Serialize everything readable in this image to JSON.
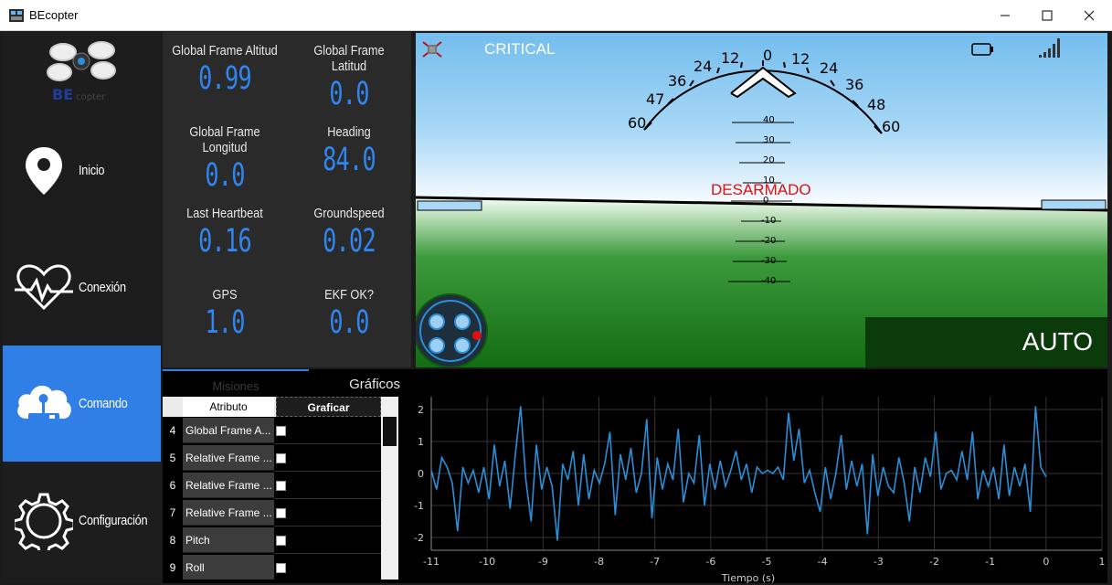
{
  "window": {
    "title": "BEcopter",
    "min": "—",
    "max": "☐",
    "close": "✕"
  },
  "sidebar": {
    "logo_text": "BEcopter",
    "items": [
      {
        "label": "Inicio",
        "icon": "location-pin-icon"
      },
      {
        "label": "Conexión",
        "icon": "heartbeat-icon"
      },
      {
        "label": "Comando",
        "icon": "cloud-joystick-icon"
      },
      {
        "label": "Configuración",
        "icon": "gear-icon"
      }
    ]
  },
  "telemetry": [
    {
      "label": "Global Frame Altitud",
      "value": "0.99"
    },
    {
      "label": "Global Frame Latitud",
      "value": "0.0"
    },
    {
      "label": "Global Frame Longitud",
      "value": "0.0"
    },
    {
      "label": "Heading",
      "value": "84.0"
    },
    {
      "label": "Last Heartbeat",
      "value": "0.16"
    },
    {
      "label": "Groundspeed",
      "value": "0.02"
    },
    {
      "label": "GPS",
      "value": "1.0"
    },
    {
      "label": "EKF OK?",
      "value": "0.0"
    }
  ],
  "hud": {
    "status": "CRITICAL",
    "armed_text": "DESARMADO",
    "mode": "AUTO",
    "roll_labels": [
      "60",
      "47",
      "36",
      "24",
      "12",
      "0",
      "12",
      "24",
      "36",
      "48",
      "60"
    ],
    "pitch_labels": [
      "40",
      "30",
      "20",
      "10",
      "0",
      "-10",
      "-20",
      "-30",
      "-40"
    ],
    "quad_badge": "2",
    "colors": {
      "sky": "#7cc3f0",
      "ground": "#1a7a1a",
      "warning": "#e01010"
    }
  },
  "tabs": {
    "misiones": "Misiones",
    "graficos": "Gráficos"
  },
  "table": {
    "headers": {
      "attribute": "Atributo",
      "plot": "Graficar"
    },
    "rows": [
      {
        "num": "4",
        "name": "Global Frame A..."
      },
      {
        "num": "5",
        "name": "Relative Frame ..."
      },
      {
        "num": "6",
        "name": "Relative Frame ..."
      },
      {
        "num": "7",
        "name": "Relative Frame ..."
      },
      {
        "num": "8",
        "name": "Pitch"
      },
      {
        "num": "9",
        "name": "Roll"
      }
    ]
  },
  "chart_data": {
    "type": "line",
    "xlabel": "Tiempo (s)",
    "ylabel": "",
    "xlim": [
      -11,
      1
    ],
    "ylim": [
      -2.4,
      2.4
    ],
    "x_ticks": [
      -11,
      -10,
      -9,
      -8,
      -7,
      -6,
      -5,
      -4,
      -3,
      -2,
      -1,
      0,
      1
    ],
    "y_ticks": [
      2,
      1,
      0,
      -1,
      -2
    ],
    "color": "#2a8fd8",
    "series": [
      {
        "values": [
          0.1,
          -0.5,
          0.5,
          0.2,
          -0.3,
          -1.8,
          0.2,
          -0.3,
          0.1,
          -0.6,
          0.2,
          -0.8,
          0.9,
          -0.4,
          0.4,
          -1.1,
          0.6,
          2.1,
          -0.2,
          -1.5,
          0.9,
          -0.5,
          0.2,
          -0.4,
          -2.1,
          0.3,
          -0.2,
          0.7,
          -1.0,
          0.6,
          -0.8,
          0.1,
          -0.3,
          0.3,
          1.3,
          -1.3,
          0.6,
          -0.2,
          0.8,
          -0.6,
          0.0,
          1.7,
          -1.4,
          0.5,
          -0.5,
          0.3,
          -0.2,
          1.4,
          -0.9,
          0.0,
          -0.3,
          1.2,
          -1.0,
          0.3,
          -0.5,
          0.4,
          -0.4,
          0.1,
          0.7,
          -0.2,
          0.3,
          -0.6,
          0.2,
          0.0,
          0.1,
          0.0,
          0.2,
          -0.2,
          1.9,
          0.4,
          1.4,
          -0.3,
          0.1,
          -0.6,
          -1.2,
          0.2,
          -0.8,
          0.0,
          1.2,
          -0.5,
          0.4,
          -0.4,
          0.3,
          -1.9,
          0.6,
          -0.7,
          0.2,
          -0.4,
          -0.6,
          0.5,
          -0.3,
          -1.5,
          0.2,
          -0.6,
          0.5,
          -0.1,
          1.3,
          -0.5,
          0.0,
          0.1,
          -0.2,
          0.7,
          -0.2,
          1.3,
          -0.8,
          0.1,
          -0.4,
          0.2,
          -0.8,
          0.9,
          -0.7,
          0.2,
          -0.4,
          0.3,
          -1.2,
          2.1,
          0.2,
          -0.1
        ]
      }
    ]
  }
}
